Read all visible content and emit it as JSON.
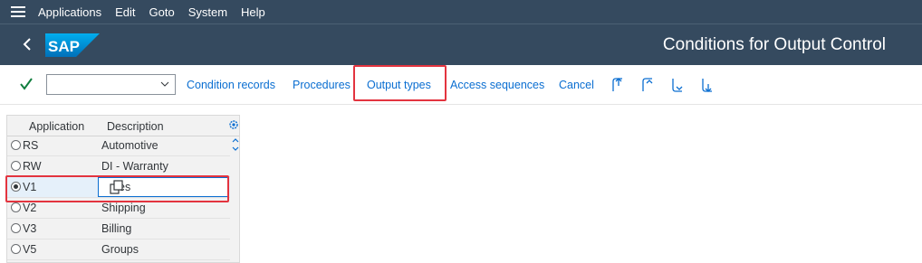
{
  "menubar": {
    "items": [
      {
        "label": "Applications"
      },
      {
        "label": "Edit"
      },
      {
        "label": "Goto"
      },
      {
        "label": "System"
      },
      {
        "label": "Help"
      }
    ]
  },
  "shell": {
    "logo_text": "SAP",
    "title": "Conditions for Output Control"
  },
  "toolbar": {
    "combo_value": "",
    "buttons": [
      {
        "label": "Condition records"
      },
      {
        "label": "Procedures"
      },
      {
        "label": "Output types"
      },
      {
        "label": "Access sequences"
      },
      {
        "label": "Cancel"
      }
    ],
    "icons": [
      "first-page-icon",
      "previous-page-icon",
      "next-page-icon",
      "last-page-icon"
    ]
  },
  "table": {
    "columns": [
      "Application",
      "Description"
    ],
    "rows": [
      {
        "code": "RS",
        "description": "Automotive",
        "selected": false
      },
      {
        "code": "RW",
        "description": "DI - Warranty",
        "selected": false
      },
      {
        "code": "V1",
        "description": "es",
        "selected": true
      },
      {
        "code": "V2",
        "description": "Shipping",
        "selected": false
      },
      {
        "code": "V3",
        "description": "Billing",
        "selected": false
      },
      {
        "code": "V5",
        "description": "Groups",
        "selected": false
      }
    ]
  },
  "colors": {
    "shell_bg": "#354a5f",
    "link_blue": "#0a6ed1",
    "highlight_red": "#e3343f",
    "check_green": "#107e3e"
  }
}
